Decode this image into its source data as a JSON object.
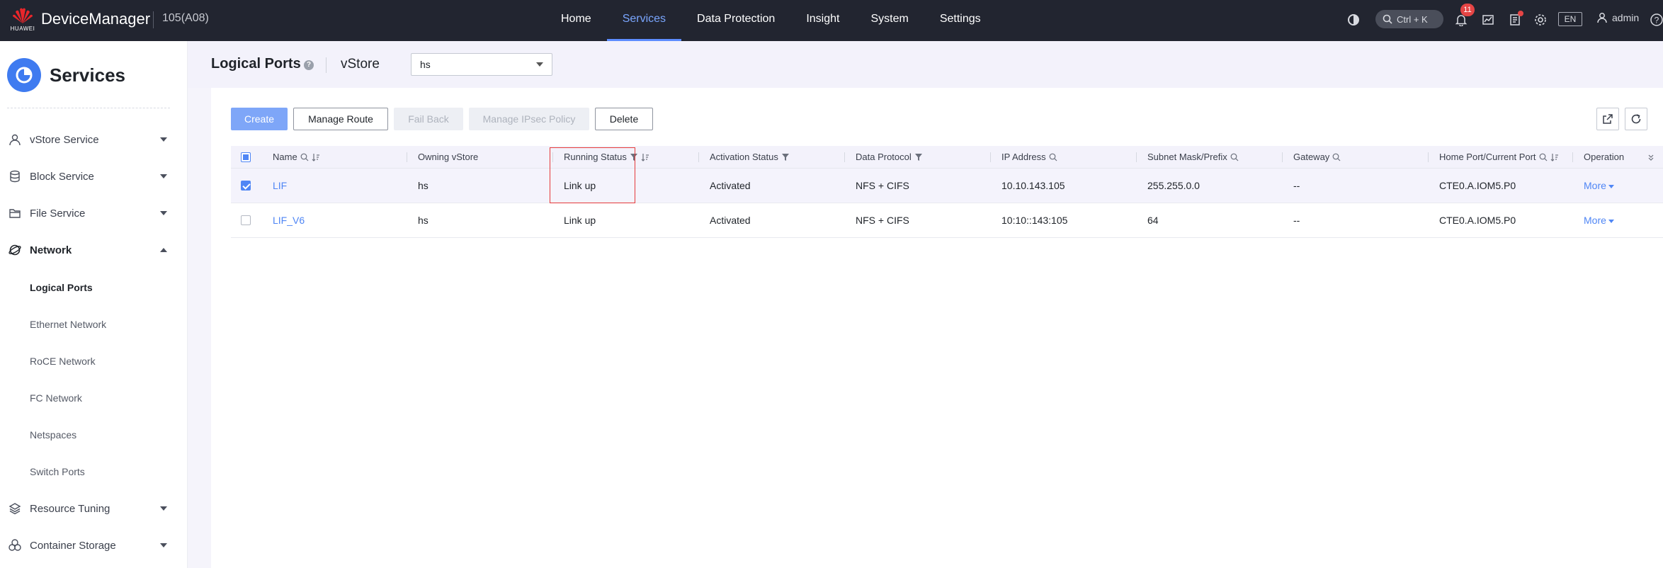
{
  "topbar": {
    "brand": "HUAWEI",
    "app_title": "DeviceManager",
    "device_id": "105(A08)",
    "nav": [
      {
        "label": "Home",
        "active": false
      },
      {
        "label": "Services",
        "active": true
      },
      {
        "label": "Data Protection",
        "active": false
      },
      {
        "label": "Insight",
        "active": false
      },
      {
        "label": "System",
        "active": false
      },
      {
        "label": "Settings",
        "active": false
      }
    ],
    "search_shortcut": "Ctrl + K",
    "notification_count": "11",
    "language": "EN",
    "user": "admin",
    "help_icon": "help-icon",
    "accent": "#5d8dff"
  },
  "sidebar": {
    "title": "Services",
    "items": [
      {
        "label": "vStore Service",
        "icon": "user-icon"
      },
      {
        "label": "Block Service",
        "icon": "database-icon"
      },
      {
        "label": "File Service",
        "icon": "folder-icon"
      },
      {
        "label": "Network",
        "icon": "network-icon"
      },
      {
        "label": "Resource Tuning",
        "icon": "layers-icon"
      },
      {
        "label": "Container Storage",
        "icon": "container-icon"
      }
    ],
    "network_sub": [
      "Logical Ports",
      "Ethernet Network",
      "RoCE Network",
      "FC Network",
      "Netspaces",
      "Switch Ports"
    ]
  },
  "page": {
    "title": "Logical Ports",
    "vstore_label": "vStore",
    "vstore_value": "hs"
  },
  "toolbar": {
    "create": "Create",
    "manage_route": "Manage Route",
    "fail_back": "Fail Back",
    "manage_ipsec": "Manage IPsec Policy",
    "delete": "Delete"
  },
  "table": {
    "columns": {
      "name": "Name",
      "owning_vstore": "Owning vStore",
      "running_status": "Running Status",
      "activation_status": "Activation Status",
      "data_protocol": "Data Protocol",
      "ip_address": "IP Address",
      "subnet": "Subnet Mask/Prefix",
      "gateway": "Gateway",
      "home_port": "Home Port/Current Port",
      "operation": "Operation"
    },
    "rows": [
      {
        "name": "LIF",
        "vstore": "hs",
        "running": "Link up",
        "activation": "Activated",
        "protocol": "NFS + CIFS",
        "ip": "10.10.143.105",
        "subnet": "255.255.0.0",
        "gateway": "--",
        "port": "CTE0.A.IOM5.P0",
        "operation": "More",
        "selected": true
      },
      {
        "name": "LIF_V6",
        "vstore": "hs",
        "running": "Link up",
        "activation": "Activated",
        "protocol": "NFS + CIFS",
        "ip": "10:10::143:105",
        "subnet": "64",
        "gateway": "--",
        "port": "CTE0.A.IOM5.P0",
        "operation": "More",
        "selected": false
      }
    ]
  }
}
